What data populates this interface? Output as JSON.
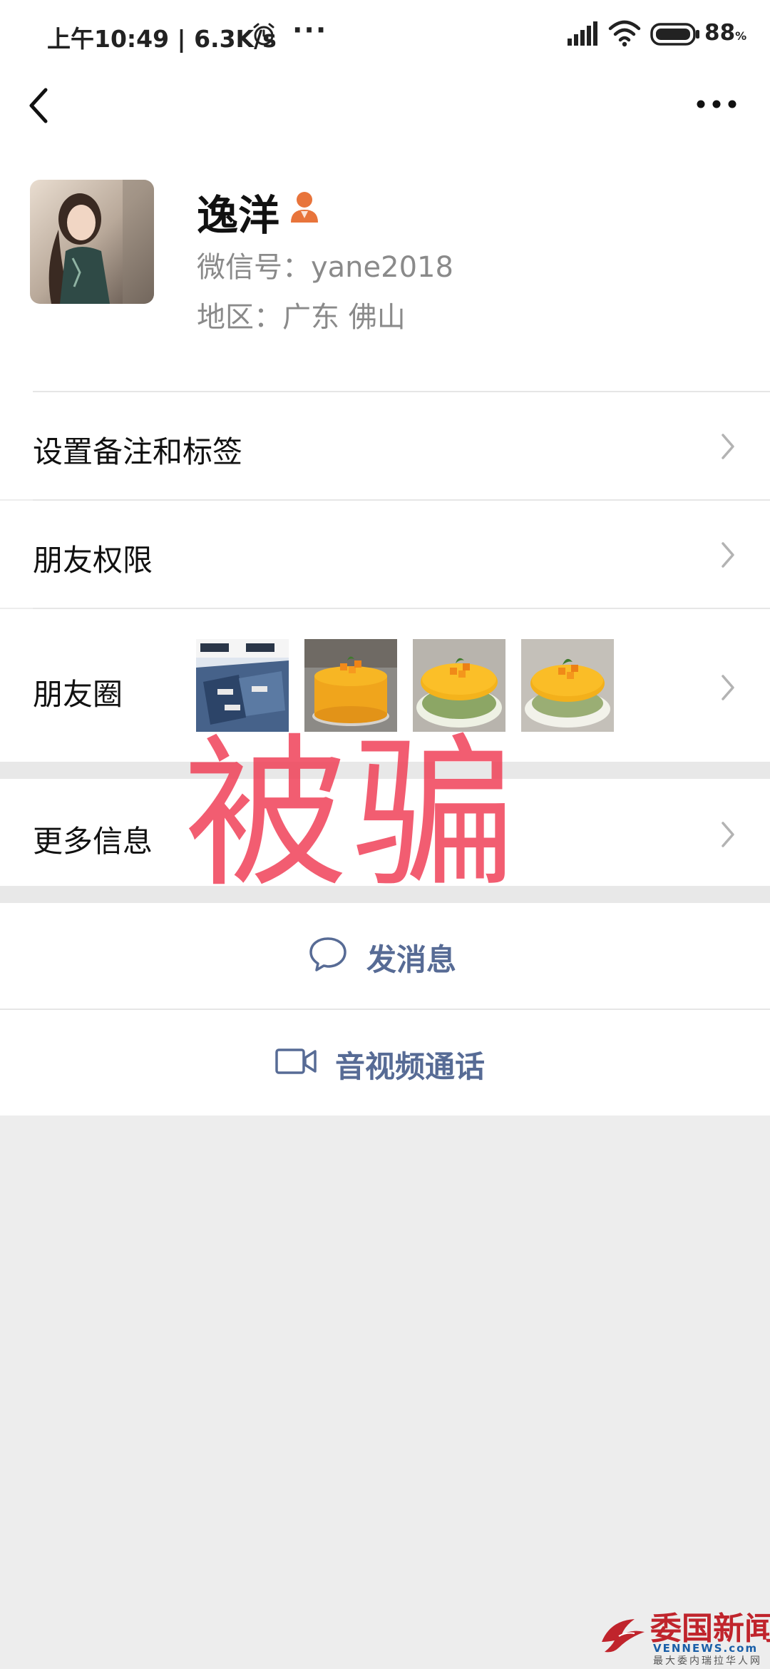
{
  "status_bar": {
    "left_text": "上午10:49 | 6.3K/s",
    "dots": "···",
    "battery_value": "88",
    "battery_unit": "%",
    "icons": [
      "alarm-icon",
      "signal-icon",
      "wifi-icon",
      "battery-icon"
    ]
  },
  "nav": {
    "back_icon": "chevron-left-icon",
    "more_icon": "more-horizontal-icon"
  },
  "profile": {
    "nickname": "逸洋",
    "wechat_id": "微信号：yane2018",
    "region": "地区：广东  佛山",
    "role_icon": "person-icon",
    "avatar_icon": "avatar-photo"
  },
  "rows": {
    "remark": "设置备注和标签",
    "permissions": "朋友权限",
    "moments": "朋友圈",
    "more_info": "更多信息"
  },
  "moments_thumbs": [
    "jeans-photo",
    "mango-mousse-photo",
    "mango-mousse-photo",
    "mango-mousse-photo"
  ],
  "actions": {
    "send_message": "发消息",
    "av_call": "音视频通话"
  },
  "overlay": {
    "stamp_text": "被骗"
  },
  "watermark": {
    "name": "委国新闻网",
    "url": "VENNEWS.com",
    "tagline": "最大委内瑞拉华人网"
  },
  "colors": {
    "link_blue": "#576b95",
    "stamp_red": "#f0435a",
    "role_orange": "#e8743b",
    "background": "#ededed"
  }
}
